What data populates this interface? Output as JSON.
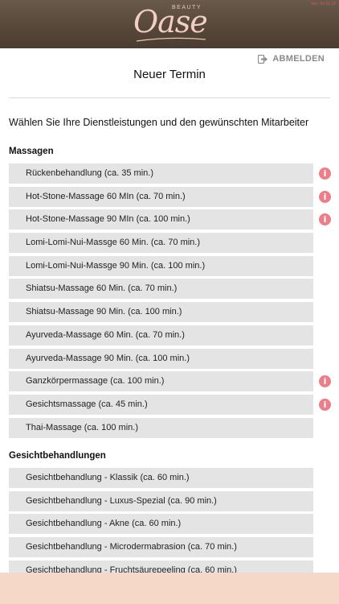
{
  "header": {
    "logo_small": "BEAUTY",
    "logo_main": "Oase",
    "version": "Ver.: 00.01.13"
  },
  "logout_label": "ABMELDEN",
  "page_title": "Neuer Termin",
  "intro": "Wählen Sie Ihre Dienstleistungen und den gewünschten Mitarbeiter",
  "sections": [
    {
      "title": "Massagen",
      "items": [
        {
          "label": "Rückenbehandlung (ca. 35 min.)",
          "info": true
        },
        {
          "label": "Hot-Stone-Massage 60 MIn (ca. 70 min.)",
          "info": true
        },
        {
          "label": "Hot-Stone-Massage 90 MIn (ca. 100 min.)",
          "info": true
        },
        {
          "label": "Lomi-Lomi-Nui-Massge 60 Min. (ca. 70 min.)",
          "info": false
        },
        {
          "label": "Lomi-Lomi-Nui-Massge 90 Min. (ca. 100 min.)",
          "info": false
        },
        {
          "label": "Shiatsu-Massage 60 Min. (ca. 70 min.)",
          "info": false
        },
        {
          "label": "Shiatsu-Massage 90 Min. (ca. 100 min.)",
          "info": false
        },
        {
          "label": "Ayurveda-Massage 60 Min. (ca. 70 min.)",
          "info": false
        },
        {
          "label": "Ayurveda-Massage 90 Min. (ca. 100 min.)",
          "info": false
        },
        {
          "label": "Ganzkörpermassage (ca. 100 min.)",
          "info": true
        },
        {
          "label": "Gesichtsmassage (ca. 45 min.)",
          "info": true
        },
        {
          "label": "Thai-Massage (ca. 100 min.)",
          "info": false
        }
      ]
    },
    {
      "title": "Gesichtbehandlungen",
      "items": [
        {
          "label": "Gesichtbehandlung - Klassik (ca. 60 min.)",
          "info": false
        },
        {
          "label": "Gesichtbehandlung - Luxus-Spezial (ca. 90 min.)",
          "info": false
        },
        {
          "label": "Gesichtbehandlung - Akne (ca. 60 min.)",
          "info": false
        },
        {
          "label": "Gesichtbehandlung - Microdermabrasion (ca. 70 min.)",
          "info": false
        },
        {
          "label": "Gesichtbehandlung - Fruchtsäurepeeling (ca. 60 min.)",
          "info": false
        }
      ]
    }
  ],
  "icons": {
    "info": "info-icon",
    "logout": "logout-icon"
  },
  "colors": {
    "header": "#574839",
    "logo": "#f2cfc3",
    "info": "#ea7f89",
    "row": "#e4e4e4",
    "footer": "#f6d8c9"
  }
}
